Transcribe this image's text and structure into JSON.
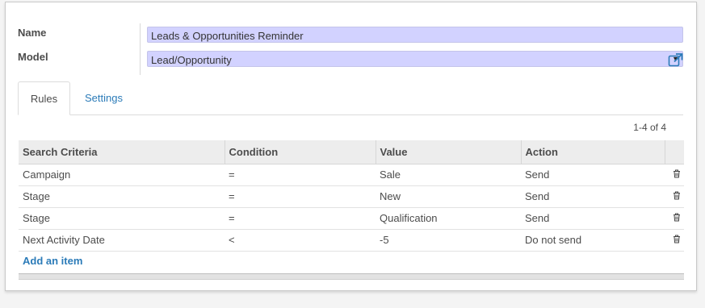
{
  "form": {
    "name_label": "Name",
    "name_value": "Leads & Opportunities Reminder",
    "model_label": "Model",
    "model_value": "Lead/Opportunity"
  },
  "tabs": [
    {
      "label": "Rules"
    },
    {
      "label": "Settings"
    }
  ],
  "pager": "1-4 of 4",
  "table": {
    "headers": [
      "Search Criteria",
      "Condition",
      "Value",
      "Action"
    ],
    "rows": [
      {
        "criteria": "Campaign",
        "condition": "=",
        "value": "Sale",
        "action": "Send"
      },
      {
        "criteria": "Stage",
        "condition": "=",
        "value": "New",
        "action": "Send"
      },
      {
        "criteria": "Stage",
        "condition": "=",
        "value": "Qualification",
        "action": "Send"
      },
      {
        "criteria": "Next Activity Date",
        "condition": "<",
        "value": "-5",
        "action": "Do not send"
      }
    ]
  },
  "add_item_label": "Add an item",
  "colors": {
    "field_bg": "#d2d2ff",
    "link": "#2b7bb8",
    "header_bg": "#ededed"
  }
}
